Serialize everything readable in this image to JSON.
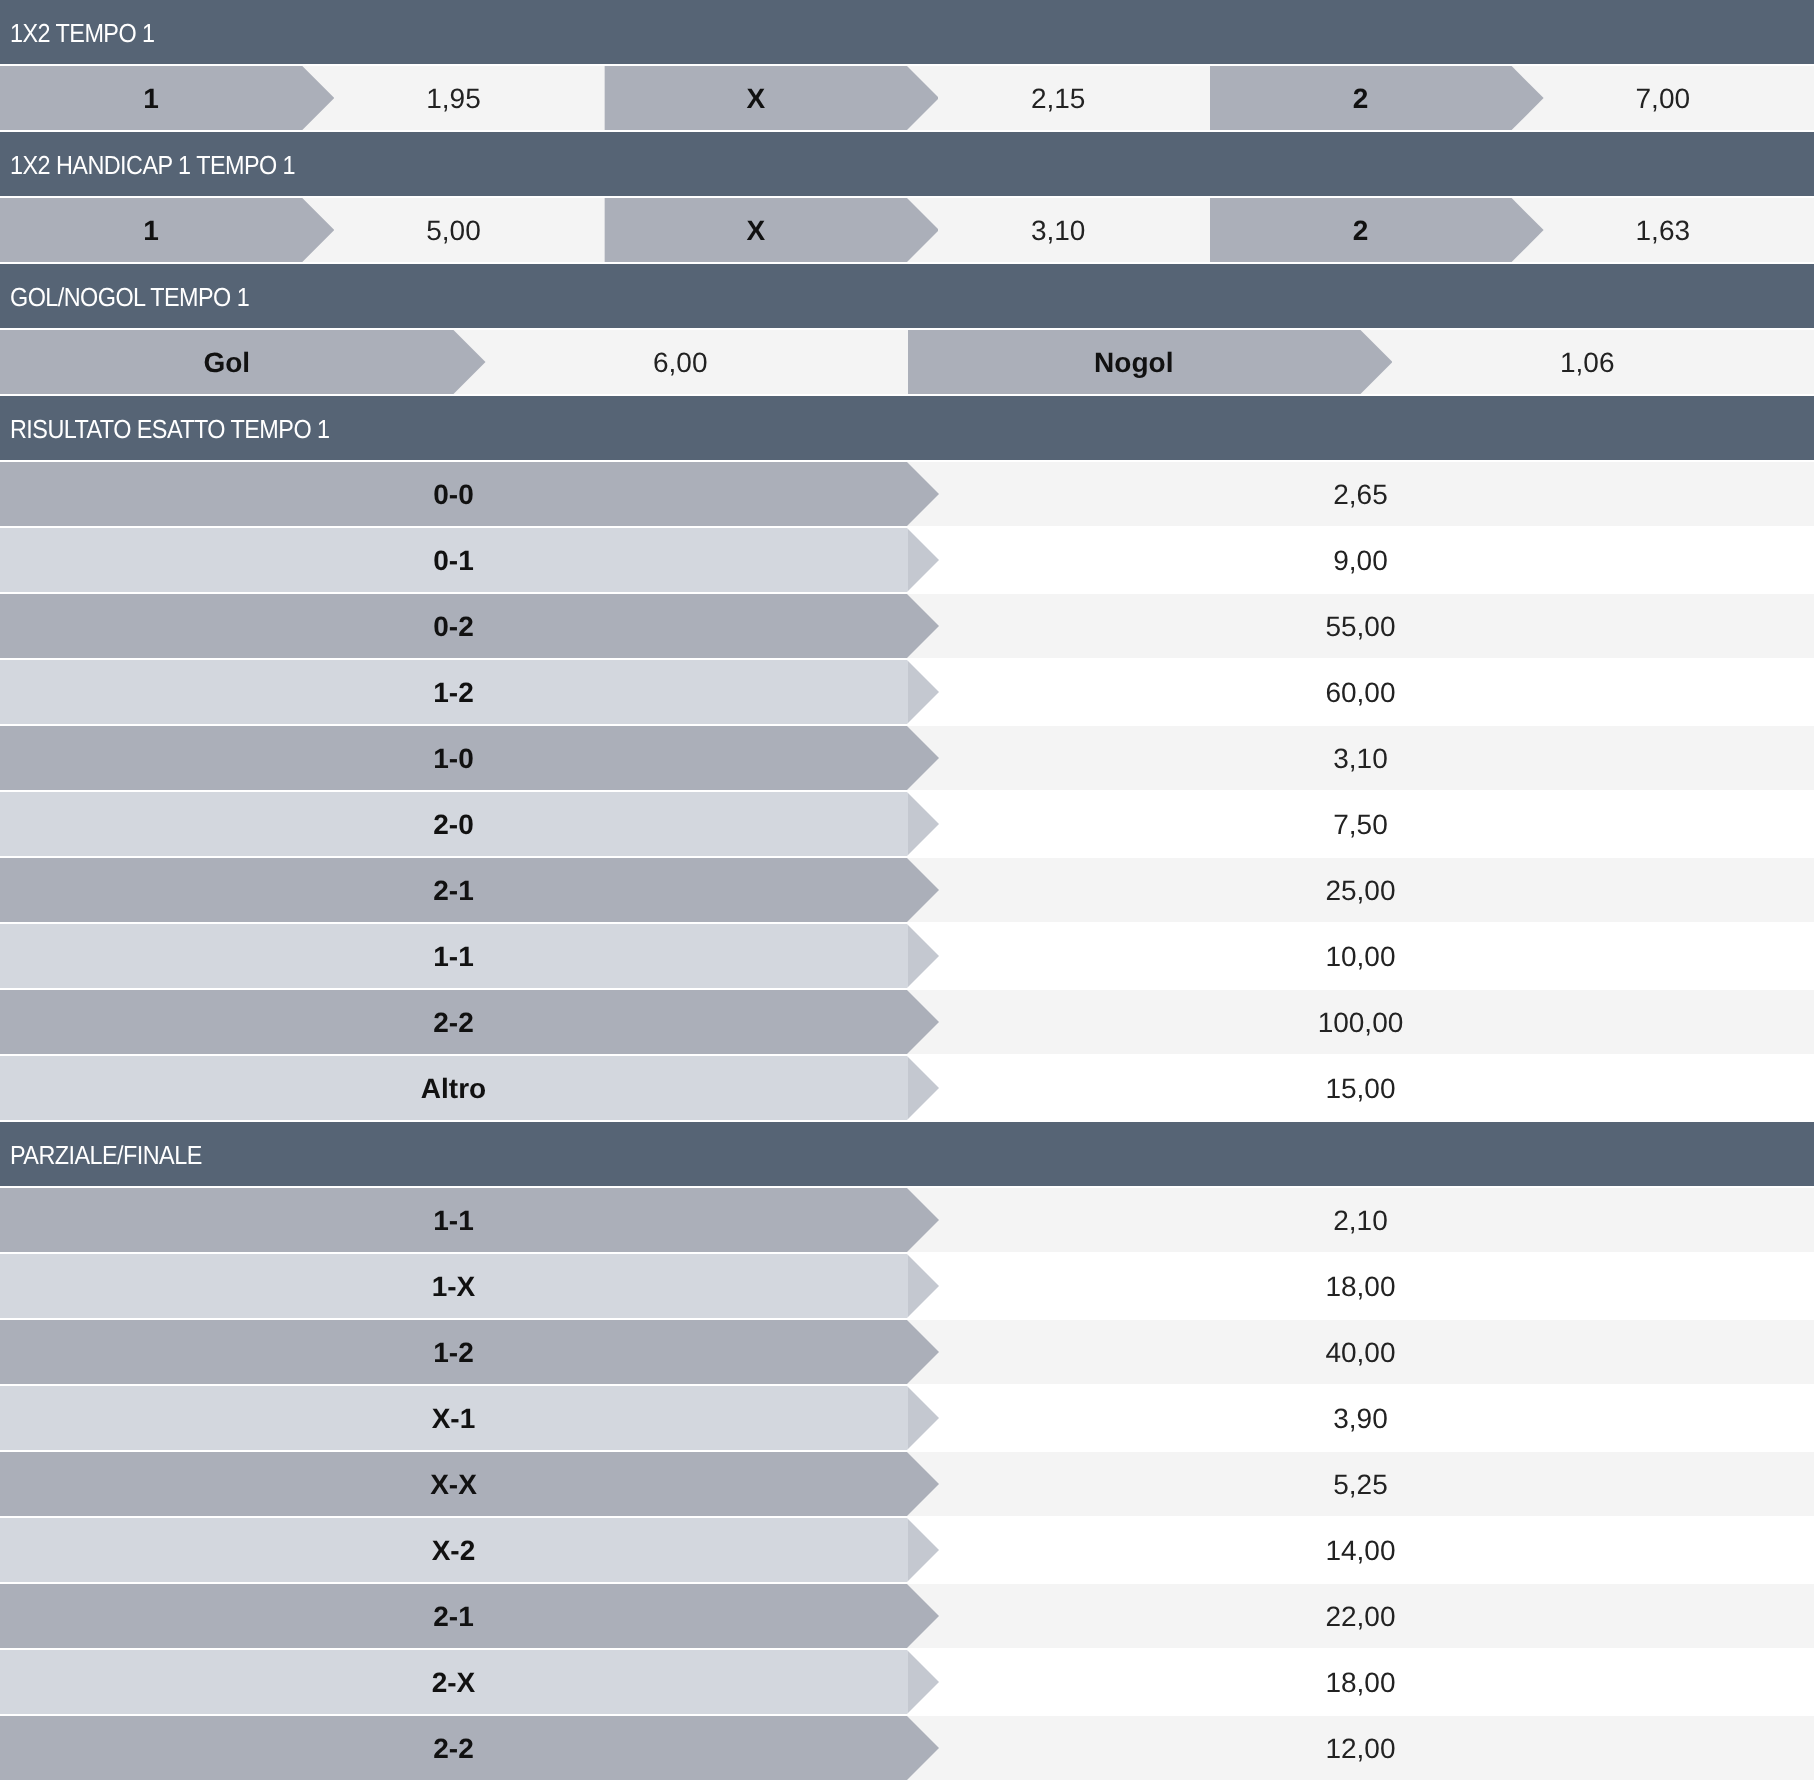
{
  "sections": [
    {
      "title": "1X2 TEMPO 1",
      "kind": "inline",
      "outcomes": [
        {
          "label": "1",
          "odds": "1,95"
        },
        {
          "label": "X",
          "odds": "2,15"
        },
        {
          "label": "2",
          "odds": "7,00"
        }
      ]
    },
    {
      "title": "1X2 HANDICAP 1 TEMPO 1",
      "kind": "inline",
      "outcomes": [
        {
          "label": "1",
          "odds": "5,00"
        },
        {
          "label": "X",
          "odds": "3,10"
        },
        {
          "label": "2",
          "odds": "1,63"
        }
      ]
    },
    {
      "title": "GOL/NOGOL TEMPO 1",
      "kind": "inline",
      "outcomes": [
        {
          "label": "Gol",
          "odds": "6,00"
        },
        {
          "label": "Nogol",
          "odds": "1,06"
        }
      ]
    },
    {
      "title": "RISULTATO ESATTO TEMPO 1",
      "kind": "list",
      "outcomes": [
        {
          "label": "0-0",
          "odds": "2,65"
        },
        {
          "label": "0-1",
          "odds": "9,00"
        },
        {
          "label": "0-2",
          "odds": "55,00"
        },
        {
          "label": "1-2",
          "odds": "60,00"
        },
        {
          "label": "1-0",
          "odds": "3,10"
        },
        {
          "label": "2-0",
          "odds": "7,50"
        },
        {
          "label": "2-1",
          "odds": "25,00"
        },
        {
          "label": "1-1",
          "odds": "10,00"
        },
        {
          "label": "2-2",
          "odds": "100,00"
        },
        {
          "label": "Altro",
          "odds": "15,00"
        }
      ]
    },
    {
      "title": "PARZIALE/FINALE",
      "kind": "list",
      "outcomes": [
        {
          "label": "1-1",
          "odds": "2,10"
        },
        {
          "label": "1-X",
          "odds": "18,00"
        },
        {
          "label": "1-2",
          "odds": "40,00"
        },
        {
          "label": "X-1",
          "odds": "3,90"
        },
        {
          "label": "X-X",
          "odds": "5,25"
        },
        {
          "label": "X-2",
          "odds": "14,00"
        },
        {
          "label": "2-1",
          "odds": "22,00"
        },
        {
          "label": "2-X",
          "odds": "18,00"
        },
        {
          "label": "2-2",
          "odds": "12,00"
        }
      ]
    }
  ]
}
